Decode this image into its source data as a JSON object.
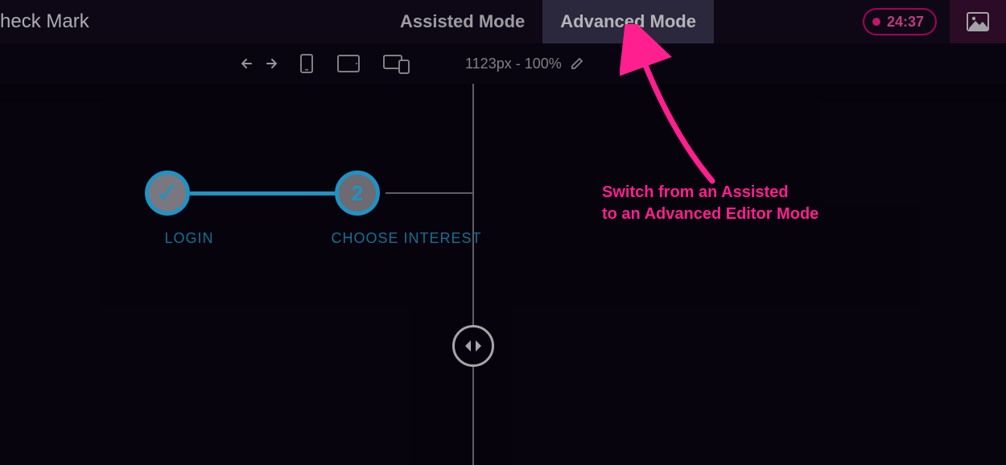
{
  "header": {
    "title_fragment": "heck Mark",
    "tabs": {
      "assisted": "Assisted Mode",
      "advanced": "Advanced Mode"
    },
    "timer": "24:37"
  },
  "toolbar": {
    "viewport_label": "1123px - 100%"
  },
  "stepper": {
    "step1_label": "LOGIN",
    "step2_number": "2",
    "step2_label": "CHOOSE INTEREST"
  },
  "annotation": {
    "line1": "Switch from an Assisted",
    "line2": "to an Advanced Editor Mode"
  }
}
